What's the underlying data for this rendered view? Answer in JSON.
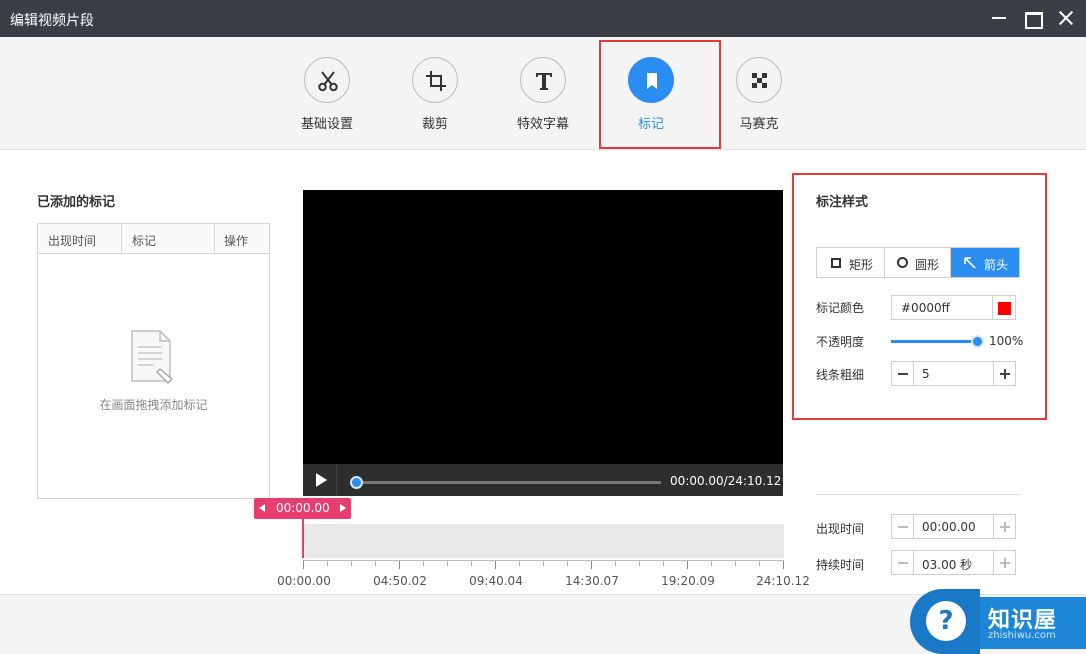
{
  "window": {
    "title": "编辑视频片段"
  },
  "toolbar": {
    "items": [
      {
        "label": "基础设置",
        "icon": "scissors-icon"
      },
      {
        "label": "裁剪",
        "icon": "crop-icon"
      },
      {
        "label": "特效字幕",
        "icon": "text-icon"
      },
      {
        "label": "标记",
        "icon": "bookmark-icon",
        "active": true
      },
      {
        "label": "马赛克",
        "icon": "mosaic-icon"
      }
    ]
  },
  "marks_panel": {
    "title": "已添加的标记",
    "columns": [
      "出现时间",
      "标记",
      "操作"
    ],
    "empty_text": "在画面拖拽添加标记"
  },
  "player": {
    "time": "00:00.00/24:10.12",
    "progress": 0
  },
  "timeline": {
    "marker": "00:00.00",
    "labels": [
      "00:00.00",
      "04:50.02",
      "09:40.04",
      "14:30.07",
      "19:20.09",
      "24:10.12"
    ]
  },
  "style_panel": {
    "title": "标注样式",
    "shapes": [
      "矩形",
      "圆形",
      "箭头"
    ],
    "selected_shape": "箭头",
    "color_label": "标记颜色",
    "color_value": "#0000ff",
    "color_swatch": "#ff0000",
    "opacity_label": "不透明度",
    "opacity_value": "100%",
    "opacity": 1.0,
    "width_label": "线条粗细",
    "width_value": "5"
  },
  "timing": {
    "appear_label": "出现时间",
    "appear_value": "00:00.00",
    "duration_label": "持续时间",
    "duration_value": "03.00 秒"
  },
  "watermark": {
    "brand": "知识屋",
    "url": "zhishiwu.com"
  },
  "colors": {
    "accent": "#2a8df2",
    "titlebar": "#3b3f45",
    "highlight_box": "#e03c3c",
    "timeline_marker": "#e83e6f"
  }
}
